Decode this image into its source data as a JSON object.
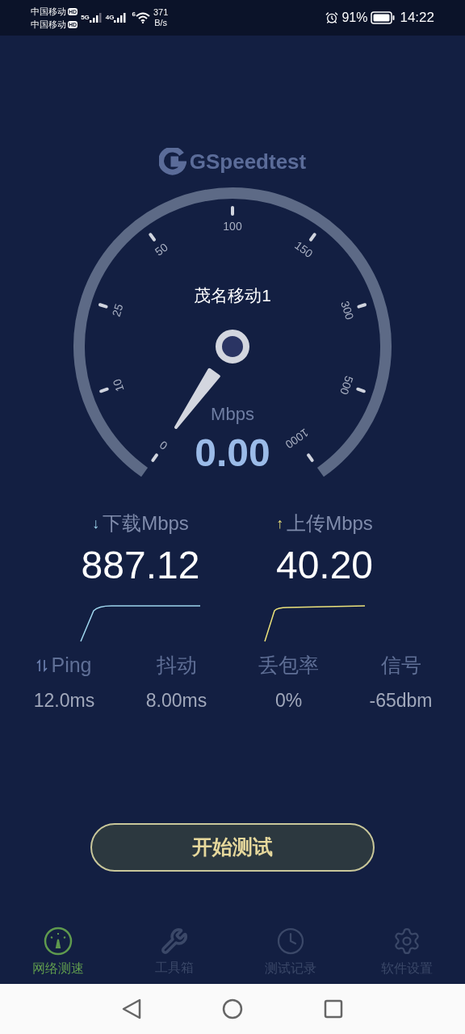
{
  "status_bar": {
    "carriers": [
      {
        "name": "中国移动",
        "badge": "HD",
        "network": "5G"
      },
      {
        "name": "中国移动",
        "badge": "HD",
        "network": "4G"
      }
    ],
    "wifi_badge": "6",
    "speed": "371",
    "speed_unit": "B/s",
    "battery": "91%",
    "time": "14:22"
  },
  "app_title": "GSpeedtest",
  "gauge": {
    "server": "茂名移动1",
    "ticks": [
      "0",
      "10",
      "25",
      "50",
      "100",
      "150",
      "300",
      "500",
      "1000"
    ],
    "unit": "Mbps",
    "reading": "0.00"
  },
  "results": [
    {
      "arrow": "↓",
      "label": "下载Mbps",
      "value": "887.12",
      "color": "#9fd6ee"
    },
    {
      "arrow": "↑",
      "label": "上传Mbps",
      "value": "40.20",
      "color": "#ece27a"
    }
  ],
  "stats": [
    {
      "label": "Ping",
      "value": "12.0ms"
    },
    {
      "label": "抖动",
      "value": "8.00ms"
    },
    {
      "label": "丢包率",
      "value": "0%"
    },
    {
      "label": "信号",
      "value": "-65dbm"
    }
  ],
  "start_button": "开始测试",
  "nav": [
    {
      "label": "网络测速",
      "selected": true
    },
    {
      "label": "工具箱",
      "selected": false
    },
    {
      "label": "测试记录",
      "selected": false
    },
    {
      "label": "软件设置",
      "selected": false
    }
  ]
}
